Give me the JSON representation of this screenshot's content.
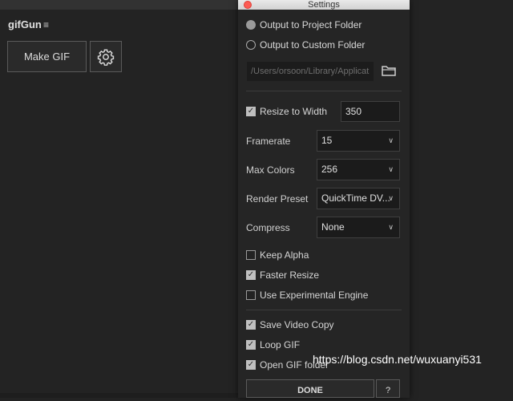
{
  "panel": {
    "title": "gifGun",
    "menu_icon": "hamburger-icon",
    "make_gif_label": "Make GIF",
    "settings_icon": "gear-icon"
  },
  "dialog": {
    "title": "Settings",
    "output_project_label": "Output to Project Folder",
    "output_custom_label": "Output to Custom Folder",
    "custom_path_placeholder": "/Users/orsoon/Library/Applicat",
    "folder_icon": "folder-icon",
    "resize_label": "Resize to Width",
    "resize_checked": true,
    "resize_value": "350",
    "framerate_label": "Framerate",
    "framerate_value": "15",
    "maxcolors_label": "Max Colors",
    "maxcolors_value": "256",
    "render_preset_label": "Render Preset",
    "render_preset_value": "QuickTime DV...",
    "compress_label": "Compress",
    "compress_value": "None",
    "keep_alpha_label": "Keep Alpha",
    "faster_resize_label": "Faster Resize",
    "experimental_label": "Use Experimental Engine",
    "save_video_label": "Save Video Copy",
    "loop_gif_label": "Loop GIF",
    "open_folder_label": "Open GIF folder",
    "done_label": "DONE",
    "help_label": "?"
  },
  "watermark": "https://blog.csdn.net/wuxuanyi531"
}
